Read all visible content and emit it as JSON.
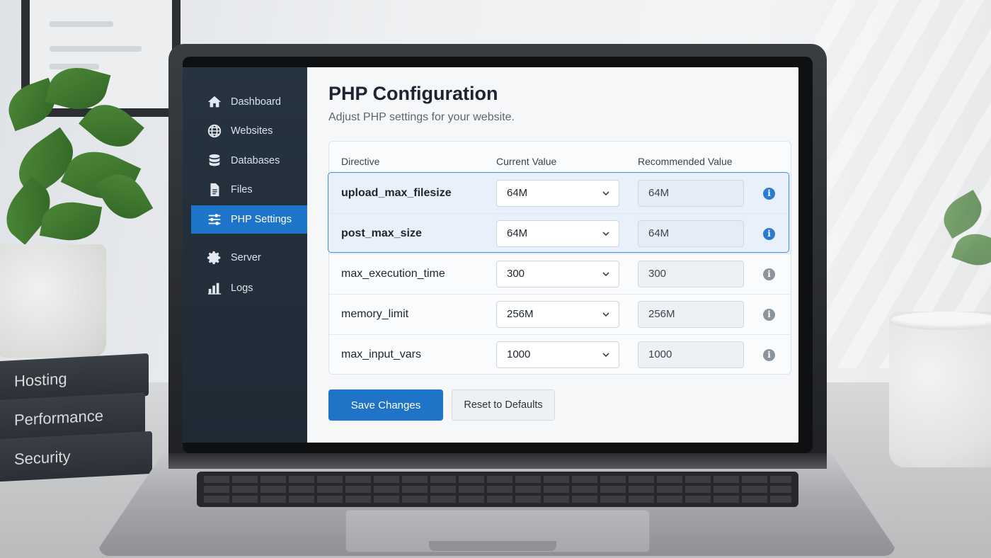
{
  "sidebar": {
    "items": [
      {
        "label": "Dashboard",
        "icon": "home-icon"
      },
      {
        "label": "Websites",
        "icon": "globe-icon"
      },
      {
        "label": "Databases",
        "icon": "database-icon"
      },
      {
        "label": "Files",
        "icon": "file-icon"
      },
      {
        "label": "PHP Settings",
        "icon": "sliders-icon",
        "active": true
      },
      {
        "label": "Server",
        "icon": "gear-icon"
      },
      {
        "label": "Logs",
        "icon": "bar-chart-icon"
      }
    ]
  },
  "page": {
    "title": "PHP Configuration",
    "subtitle": "Adjust PHP settings for your website."
  },
  "table": {
    "headers": [
      "Directive",
      "Current Value",
      "Recommended Value"
    ],
    "rows": [
      {
        "directive": "upload_max_filesize",
        "current": "64M",
        "recommended": "64M",
        "highlighted": true
      },
      {
        "directive": "post_max_size",
        "current": "64M",
        "recommended": "64M",
        "highlighted": true
      },
      {
        "directive": "max_execution_time",
        "current": "300",
        "recommended": "300",
        "highlighted": false
      },
      {
        "directive": "memory_limit",
        "current": "256M",
        "recommended": "256M",
        "highlighted": false
      },
      {
        "directive": "max_input_vars",
        "current": "1000",
        "recommended": "1000",
        "highlighted": false
      }
    ]
  },
  "actions": {
    "save_label": "Save Changes",
    "reset_label": "Reset to Defaults"
  },
  "books": [
    "Hosting",
    "Performance",
    "Security"
  ],
  "colors": {
    "accent": "#1f74c8",
    "sidebar_bg": "#263340",
    "highlight_bg": "#e8f1fb",
    "highlight_border": "#4a90d9"
  }
}
